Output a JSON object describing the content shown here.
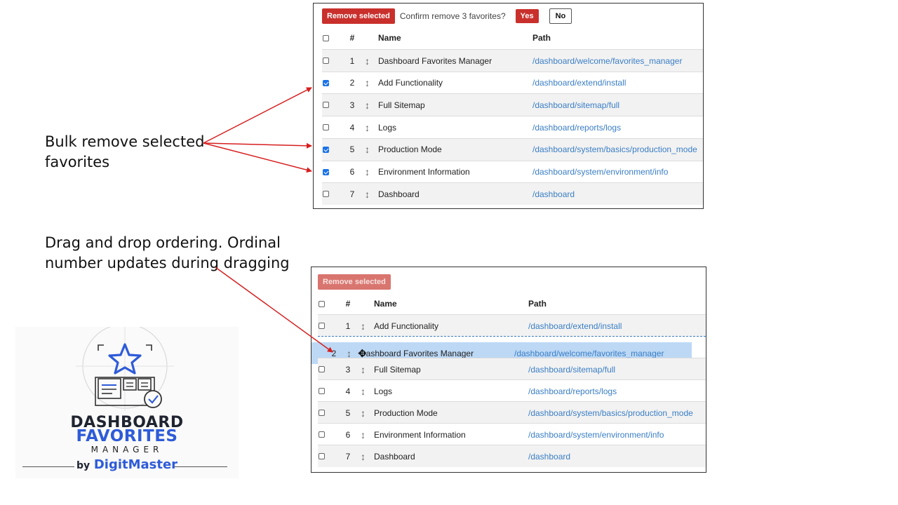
{
  "annotations": {
    "bulk_remove": "Bulk remove selected favorites",
    "drag_drop": "Drag and drop ordering. Ordinal number updates during dragging"
  },
  "panel_top": {
    "remove_label": "Remove selected",
    "confirm_text": "Confirm remove 3 favorites?",
    "yes_label": "Yes",
    "no_label": "No",
    "columns": {
      "num": "#",
      "name": "Name",
      "path": "Path"
    },
    "rows": [
      {
        "num": "1",
        "name": "Dashboard Favorites Manager",
        "path": "/dashboard/welcome/favorites_manager",
        "checked": false
      },
      {
        "num": "2",
        "name": "Add Functionality",
        "path": "/dashboard/extend/install",
        "checked": true
      },
      {
        "num": "3",
        "name": "Full Sitemap",
        "path": "/dashboard/sitemap/full",
        "checked": false
      },
      {
        "num": "4",
        "name": "Logs",
        "path": "/dashboard/reports/logs",
        "checked": false
      },
      {
        "num": "5",
        "name": "Production Mode",
        "path": "/dashboard/system/basics/production_mode",
        "checked": true
      },
      {
        "num": "6",
        "name": "Environment Information",
        "path": "/dashboard/system/environment/info",
        "checked": true
      },
      {
        "num": "7",
        "name": "Dashboard",
        "path": "/dashboard",
        "checked": false
      }
    ]
  },
  "panel_bottom": {
    "remove_label": "Remove selected",
    "columns": {
      "num": "#",
      "name": "Name",
      "path": "Path"
    },
    "rows": [
      {
        "num": "1",
        "name": "Add Functionality",
        "path": "/dashboard/extend/install"
      },
      {
        "num": "2",
        "name": "Dashboard Favorites Manager",
        "path": "/dashboard/welcome/favorites_manager",
        "dragging": true
      },
      {
        "num": "3",
        "name": "Full Sitemap",
        "path": "/dashboard/sitemap/full"
      },
      {
        "num": "4",
        "name": "Logs",
        "path": "/dashboard/reports/logs"
      },
      {
        "num": "5",
        "name": "Production Mode",
        "path": "/dashboard/system/basics/production_mode"
      },
      {
        "num": "6",
        "name": "Environment Information",
        "path": "/dashboard/system/environment/info"
      },
      {
        "num": "7",
        "name": "Dashboard",
        "path": "/dashboard"
      }
    ]
  },
  "logo": {
    "line1": "DASHBOARD",
    "line2": "FAVORITES",
    "line3": "MANAGER",
    "by": "by",
    "brand": "DigitMaster"
  },
  "colors": {
    "danger": "#c9302c",
    "link": "#3a7ec6",
    "checkbox_checked": "#1a73e8",
    "drag_row": "#bcd8f5",
    "arrow": "#d61f1f",
    "logo_blue": "#2e5bd8"
  },
  "icons": {
    "drag_handle": "vertical-double-arrow-icon",
    "move_cursor": "move-cursor-icon",
    "logo_star": "star-icon",
    "logo_check": "check-circle-icon"
  }
}
